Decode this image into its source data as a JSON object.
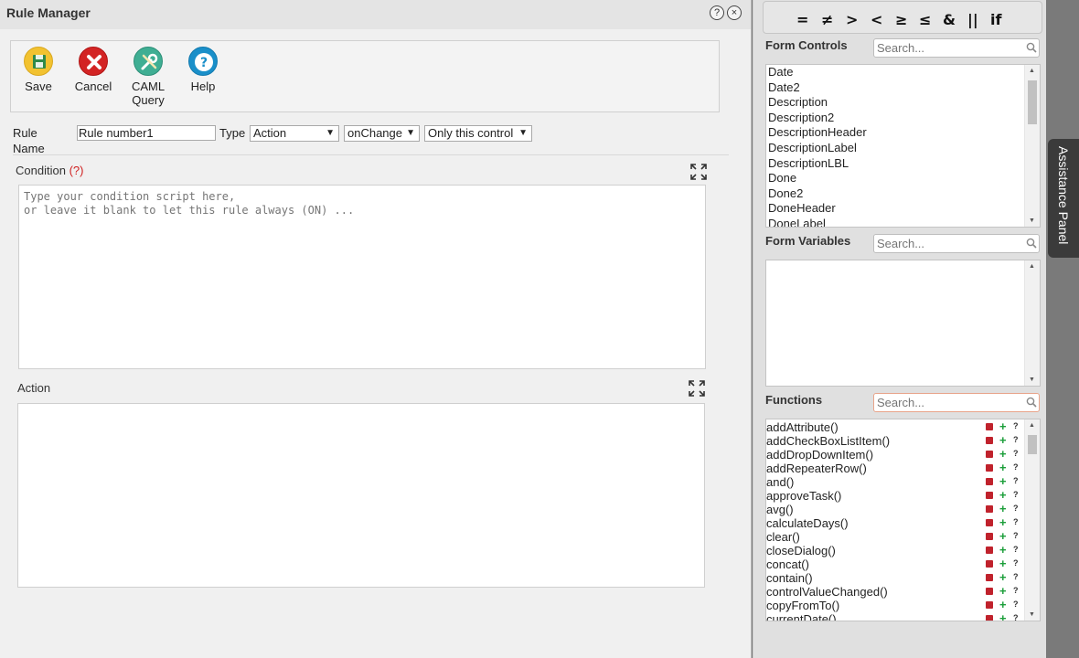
{
  "dialog": {
    "title": "Rule Manager",
    "help_btn": "?",
    "close_btn": "×"
  },
  "toolbar": {
    "save": "Save",
    "cancel": "Cancel",
    "caml": "CAML\nQuery",
    "help": "Help"
  },
  "rule": {
    "name_label": "Rule Name",
    "name_value": "Rule number1",
    "type_label": "Type",
    "type_value": "Action",
    "event_value": "onChange",
    "scope_value": "Only this control"
  },
  "condition": {
    "label": "Condition",
    "help": "(?)",
    "placeholder": "Type your condition script here,\nor leave it blank to let this rule always (ON) ..."
  },
  "action": {
    "label": "Action"
  },
  "panel": {
    "operators": [
      "=",
      "≠",
      ">",
      "<",
      "≥",
      "≤",
      "&",
      "||",
      "if"
    ],
    "form_controls": {
      "label": "Form Controls",
      "search_placeholder": "Search...",
      "items": [
        "Date",
        "Date2",
        "Description",
        "Description2",
        "DescriptionHeader",
        "DescriptionLabel",
        "DescriptionLBL",
        "Done",
        "Done2",
        "DoneHeader",
        "DoneLabel"
      ]
    },
    "form_variables": {
      "label": "Form Variables",
      "search_placeholder": "Search..."
    },
    "functions": {
      "label": "Functions",
      "search_placeholder": "Search...",
      "items": [
        "addAttribute()",
        "addCheckBoxListItem()",
        "addDropDownItem()",
        "addRepeaterRow()",
        "and()",
        "approveTask()",
        "avg()",
        "calculateDays()",
        "clear()",
        "closeDialog()",
        "concat()",
        "contain()",
        "controlValueChanged()",
        "copyFromTo()",
        "currentDate()"
      ]
    }
  },
  "assistance_tab": "Assistance Panel"
}
